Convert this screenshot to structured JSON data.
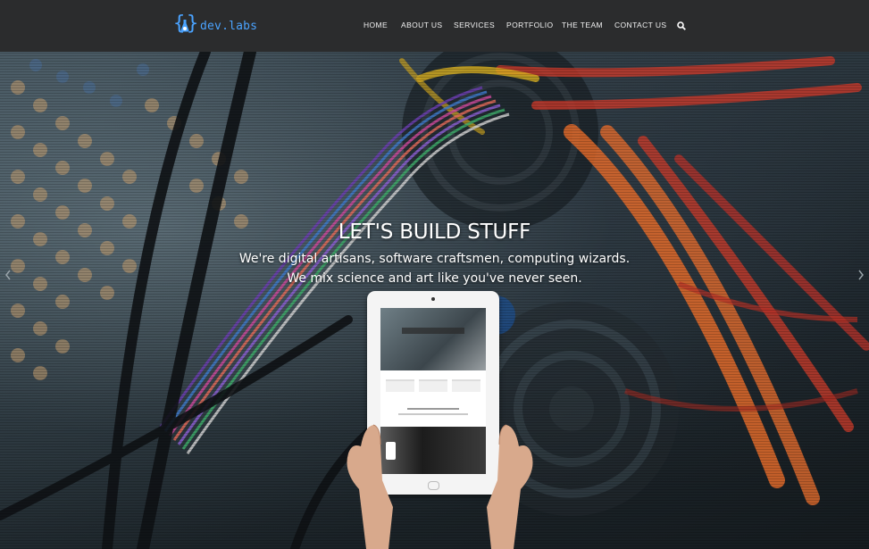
{
  "brand": {
    "name": "dev.labs",
    "color": "#4aa3ff"
  },
  "nav": {
    "items": [
      {
        "label": "HOME"
      },
      {
        "label": "ABOUT US"
      },
      {
        "label": "SERVICES"
      },
      {
        "label": "PORTFOLIO"
      },
      {
        "label": "THE TEAM"
      },
      {
        "label": "CONTACT US"
      }
    ],
    "search_icon": "search-icon"
  },
  "hero": {
    "title": "LET'S BUILD STUFF",
    "line1": "We're digital artisans, software craftsmen, computing wizards.",
    "line2": "We mix science and art like you've never seen.",
    "prev_icon": "chevron-left-icon",
    "next_icon": "chevron-right-icon"
  },
  "colors": {
    "navbar": "#2b2c2d",
    "nav_text": "#f2f2f2",
    "hero_text": "#ffffff"
  }
}
